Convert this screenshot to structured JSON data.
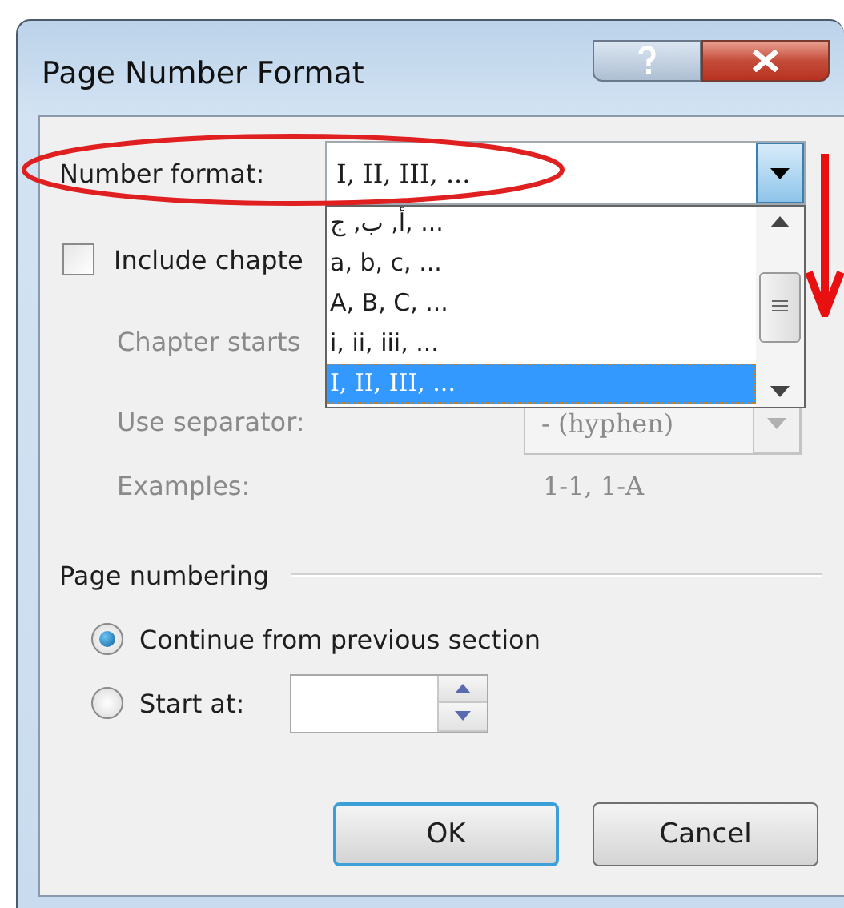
{
  "window": {
    "title": "Page Number Format"
  },
  "number_format": {
    "label": "Number format:",
    "value": "I, II, III, ...",
    "open": true,
    "options": [
      {
        "label": "أ, ب, ج, ...",
        "selected": false
      },
      {
        "label": "a, b, c, ...",
        "selected": false
      },
      {
        "label": "A, B, C, ...",
        "selected": false
      },
      {
        "label": "i, ii, iii, ...",
        "selected": false
      },
      {
        "label": "I, II, III, ...",
        "selected": true
      }
    ]
  },
  "include_chapter": {
    "label": "Include chapte",
    "checked": false
  },
  "chapter_starts": {
    "label": "Chapter starts",
    "disabled": true
  },
  "separator": {
    "label": "Use separator:",
    "value": "-   (hyphen)",
    "disabled": true
  },
  "examples": {
    "label": "Examples:",
    "value": "1-1, 1-A",
    "disabled": true
  },
  "page_numbering": {
    "title": "Page numbering",
    "options": [
      {
        "label": "Continue from previous section",
        "selected": true
      },
      {
        "label": "Start at:",
        "selected": false
      }
    ]
  },
  "buttons": [
    {
      "label": "OK",
      "default": true
    },
    {
      "label": "Cancel",
      "default": false
    }
  ],
  "annotations": [
    {
      "kind": "ellipse"
    },
    {
      "kind": "arrow"
    }
  ]
}
